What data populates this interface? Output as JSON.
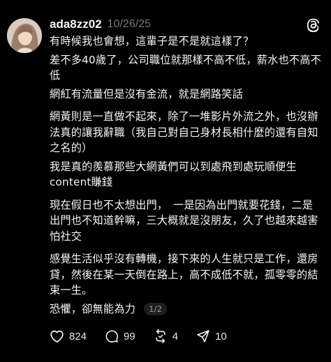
{
  "post": {
    "username": "ada8zz02",
    "timestamp": "10/26/25",
    "paragraphs": [
      "有時候我也會想，這輩子是不是就這樣了？",
      "差不多40歲了，公司職位就那樣不高不低，薪水也不高不低",
      "網紅有流量但是沒有金流，就是網路笑話",
      "網黃則是一直做不起來，除了一堆影片外流之外，也沒辦法真的讓我辭職（我自己對自己身材長相什麼的還有自知之名的）",
      "我是真的羨慕那些大網黃們可以到處飛到處玩順便生content賺錢",
      "現在假日也不太想出門，　一是因為出門就要花錢，二是出門也不知道幹嘛，三大概就是沒朋友，久了也越來越害怕社交",
      "感覺生活似乎沒有轉機，接下來的人生就只是工作，還房貸，然後在某一天倒在路上，高不成低不就，孤零零的結束一生。",
      "恐懼，卻無能為力"
    ],
    "page_indicator": "1/2"
  },
  "actions": {
    "likes": "824",
    "comments": "99",
    "reposts": "4",
    "shares": "10"
  },
  "icons": {
    "brand": "threads-logo-icon",
    "like": "heart-icon",
    "comment": "comment-bubble-icon",
    "repost": "repost-icon",
    "share": "share-send-icon"
  },
  "colors": {
    "background": "#000000",
    "text": "#f3f5f7",
    "muted": "#777777"
  }
}
